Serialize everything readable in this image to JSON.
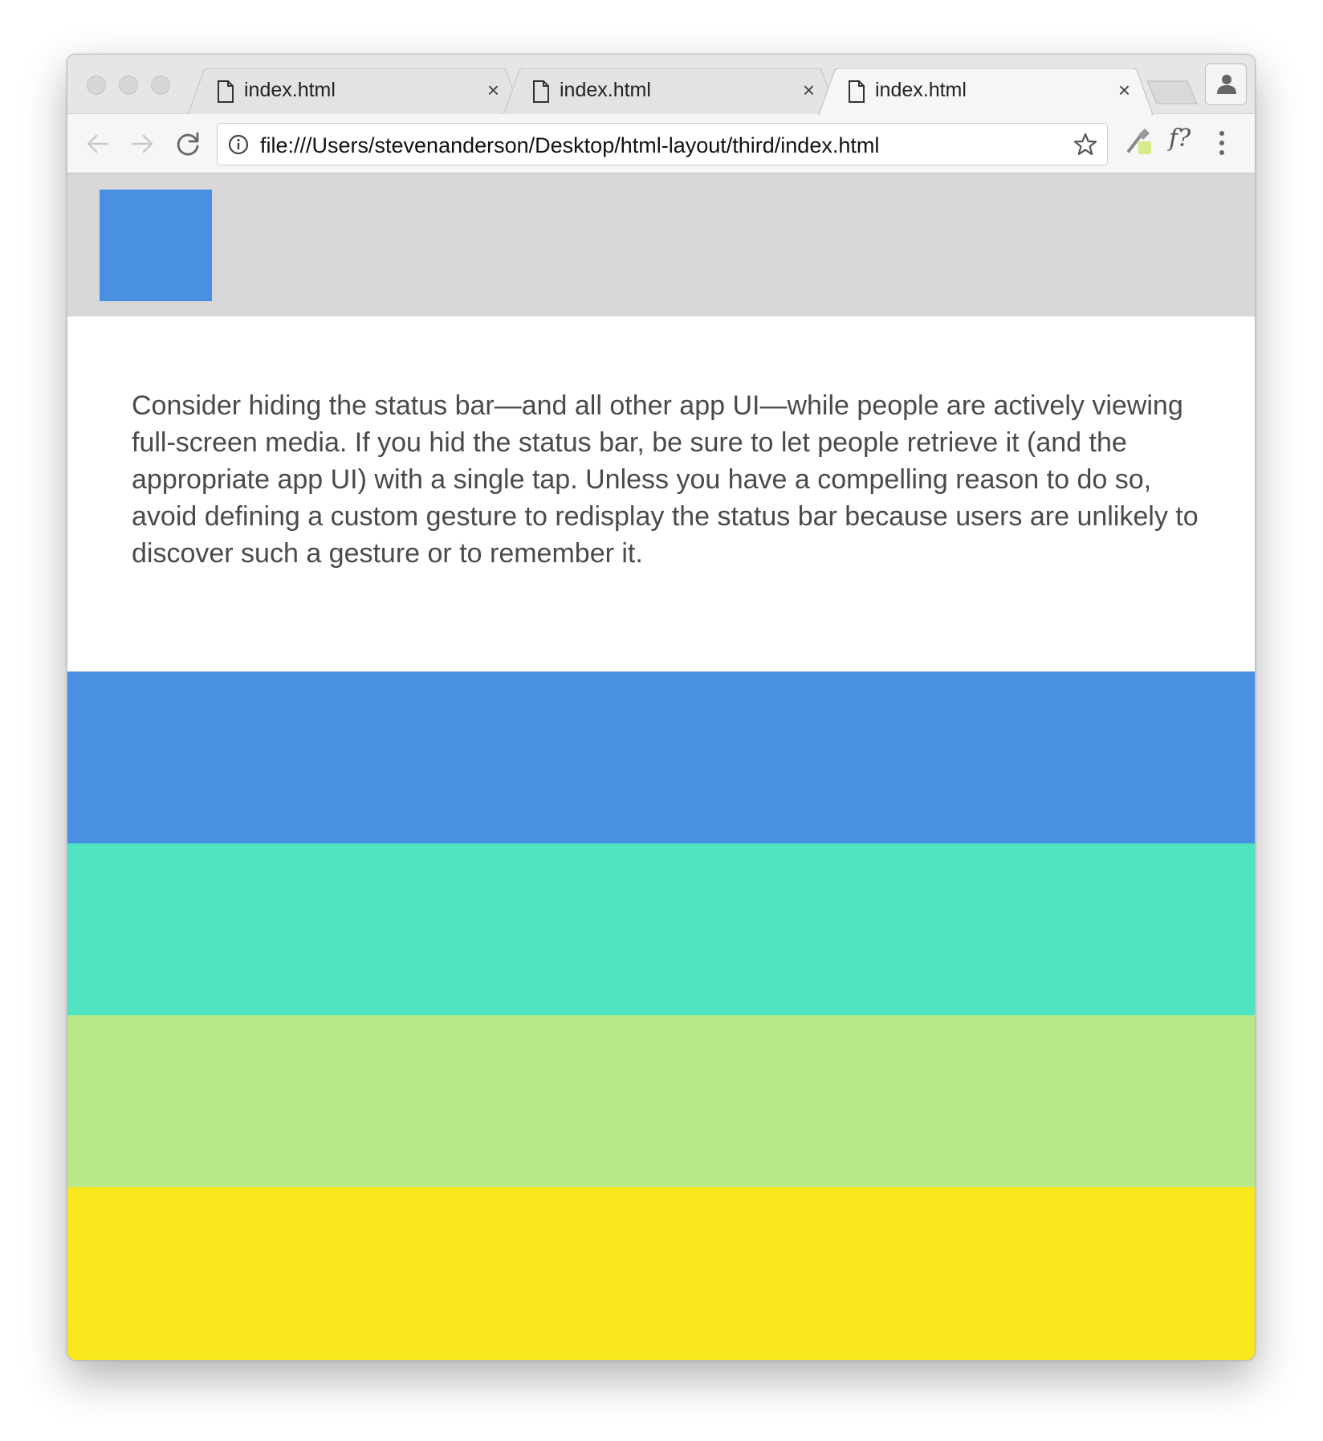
{
  "browser": {
    "tabs": [
      {
        "label": "index.html",
        "close": "×"
      },
      {
        "label": "index.html",
        "close": "×"
      },
      {
        "label": "index.html",
        "close": "×"
      }
    ],
    "url": "file:///Users/stevenanderson/Desktop/html-layout/third/index.html",
    "extension_label": "f?"
  },
  "page": {
    "paragraph": "Consider hiding the status bar—and all other app UI—while people are actively viewing full-screen media. If you hid the status bar, be sure to let people retrieve it (and the appropriate app UI) with a single tap. Unless you have a compelling reason to do so, avoid defining a custom gesture to redisplay the status bar because users are unlikely to discover such a gesture or to remember it."
  },
  "colors": {
    "header_bg": "#d8d8d8",
    "logo_box": "#4a90e2",
    "band_blue": "#4a90e2",
    "band_teal": "#50e3c2",
    "band_green": "#b8e986",
    "band_yellow": "#f8e71c"
  }
}
